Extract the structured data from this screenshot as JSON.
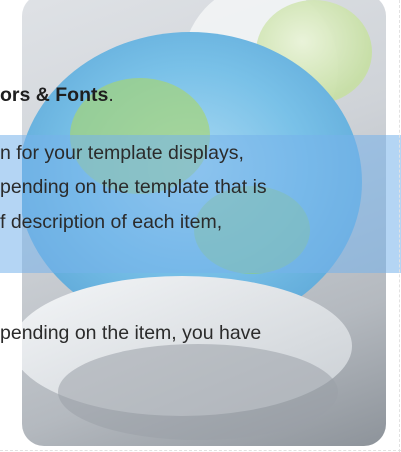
{
  "doc": {
    "line1_bold": "ors & Fonts",
    "line1_tail": ".",
    "highlight_lines": [
      "n for your template displays,",
      "pending on the template that is",
      "f description of each item,"
    ],
    "line5": "pending on the item, you have"
  },
  "colors": {
    "highlight": "#76b2eb",
    "text": "#2b2b2b"
  },
  "icons": {
    "background": "macos-style-wallpaper-graphic"
  }
}
